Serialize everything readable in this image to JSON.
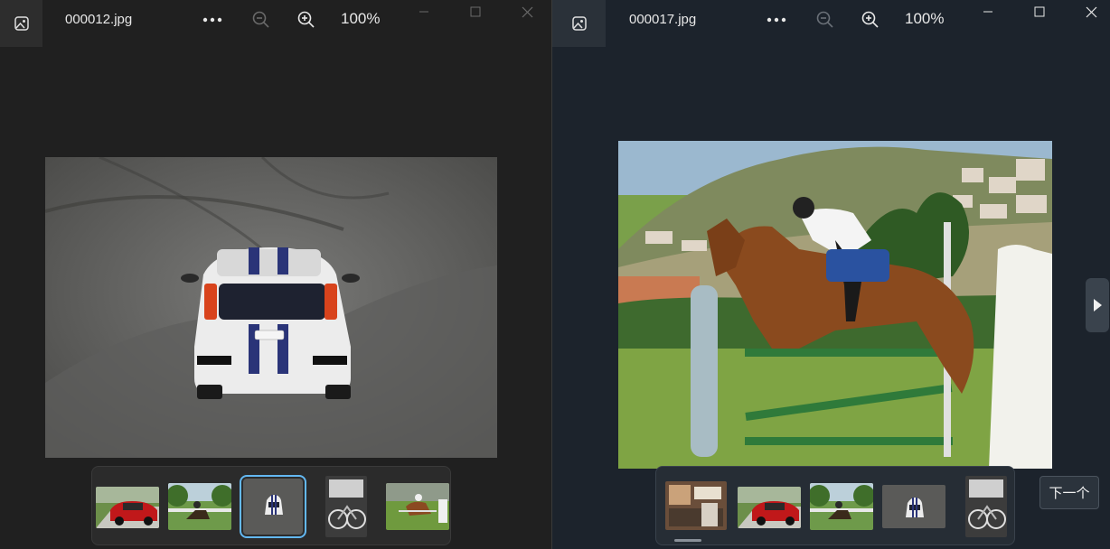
{
  "left_window": {
    "filename": "000012.jpg",
    "zoom": "100%",
    "more_icon": "more-icon",
    "zoom_out_icon": "zoom-out-icon",
    "zoom_in_icon": "zoom-in-icon",
    "thumbnails": [
      "red-car",
      "horse-riders",
      "white-car",
      "bw-bicycle",
      "horse-jump"
    ],
    "selected_thumbnail": 2
  },
  "right_window": {
    "filename": "000017.jpg",
    "zoom": "100%",
    "thumbnails": [
      "kitchen",
      "red-car",
      "horse-riders",
      "white-car",
      "bw-bicycle"
    ],
    "next_tooltip": "下一个"
  },
  "colors": {
    "accent": "#63b8f2",
    "left_bg": "#202020",
    "right_bg": "#1c232c"
  }
}
